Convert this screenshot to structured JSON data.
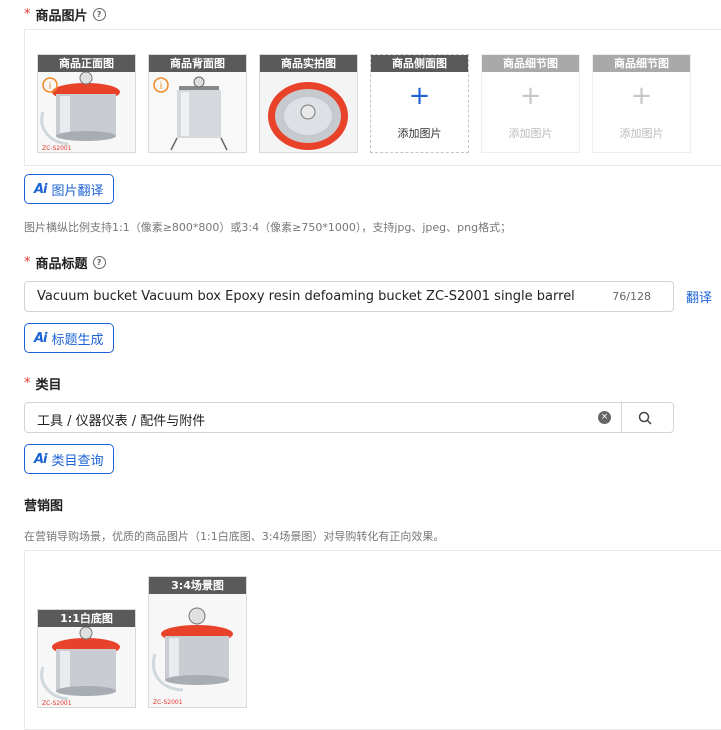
{
  "product_images": {
    "label": "商品图片",
    "required_mark": "*",
    "slots": [
      {
        "title": "商品正面图",
        "caption": "ZC-S2001"
      },
      {
        "title": "商品背面图",
        "caption": ""
      },
      {
        "title": "商品实拍图",
        "caption": ""
      }
    ],
    "add_slots": [
      {
        "title": "商品侧面图",
        "add_label": "添加图片",
        "enabled": true
      },
      {
        "title": "商品细节图",
        "add_label": "添加图片",
        "enabled": false
      },
      {
        "title": "商品细节图",
        "add_label": "添加图片",
        "enabled": false
      }
    ],
    "ai_button": "图片翻译",
    "ai_mark": "Ai",
    "hint": "图片横纵比例支持1:1（像素≥800*800）或3:4（像素≥750*1000），支持jpg、jpeg、png格式；"
  },
  "product_title": {
    "label": "商品标题",
    "required_mark": "*",
    "value": "Vacuum bucket Vacuum box Epoxy resin defoaming bucket ZC-S2001 single barrel",
    "counter": "76/128",
    "translate_link": "翻译",
    "ai_button": "标题生成",
    "ai_mark": "Ai"
  },
  "category": {
    "label": "类目",
    "required_mark": "*",
    "value": "工具 / 仪器仪表 / 配件与附件",
    "ai_button": "类目查询",
    "ai_mark": "Ai"
  },
  "marketing": {
    "label": "营销图",
    "hint": "在营销导购场景，优质的商品图片（1:1白底图、3:4场景图）对导购转化有正向效果。",
    "images": [
      {
        "title": "1:1白底图",
        "caption": "ZC-S2001"
      },
      {
        "title": "3:4场景图",
        "caption": "ZC-S2001"
      }
    ]
  },
  "colors": {
    "accent": "#1d63d6",
    "required": "#e0362c",
    "vessel_lid": "#e8432a"
  }
}
